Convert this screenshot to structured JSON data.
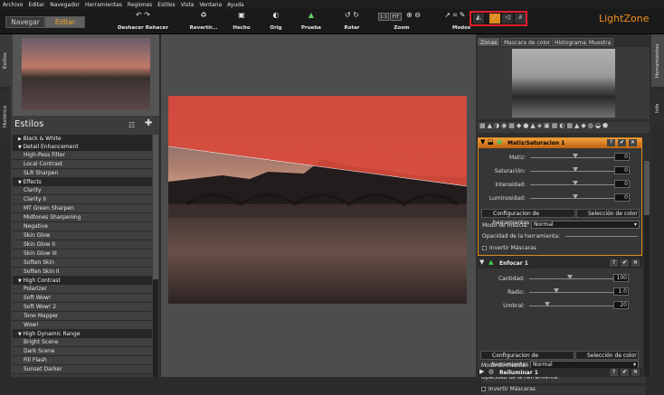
{
  "menu": [
    "Archivo",
    "Editar",
    "Navegador",
    "Herramientas",
    "Regiones",
    "Estilos",
    "Vista",
    "Ventana",
    "Ayuda"
  ],
  "modes": {
    "navegar": "Navegar",
    "editar": "Editar"
  },
  "toolbar": {
    "undo": "Deshacer Rehacer",
    "revert": "Revertir...",
    "done": "Hecho",
    "orig": "Orig",
    "proof": "Prueba",
    "rotate": "Rotar",
    "zoom": "Zoom",
    "modes": "Modos",
    "zoom_11": "1:1",
    "zoom_fit": "FIT"
  },
  "brand": "LightZone",
  "left_tabs": {
    "estilos": "Estilos",
    "historico": "Histórico"
  },
  "styles": {
    "title": "Estilos",
    "items": [
      {
        "t": "cat",
        "l": "Black & White",
        "o": false
      },
      {
        "t": "cat",
        "l": "Detail Enhancement",
        "o": true
      },
      {
        "t": "item",
        "l": "High-Pass Filter"
      },
      {
        "t": "item",
        "l": "Local Contrast"
      },
      {
        "t": "item",
        "l": "SLR Sharpen"
      },
      {
        "t": "cat",
        "l": "Effects",
        "o": true
      },
      {
        "t": "item",
        "l": "Clarity"
      },
      {
        "t": "item",
        "l": "Clarity II"
      },
      {
        "t": "item",
        "l": "MT Green Sharpen"
      },
      {
        "t": "item",
        "l": "Midtones Sharpening"
      },
      {
        "t": "item",
        "l": "Negative"
      },
      {
        "t": "item",
        "l": "Skin Glow"
      },
      {
        "t": "item",
        "l": "Skin Glow II"
      },
      {
        "t": "item",
        "l": "Skin Glow III"
      },
      {
        "t": "item",
        "l": "Soften Skin"
      },
      {
        "t": "item",
        "l": "Soften Skin II"
      },
      {
        "t": "cat",
        "l": "High Contrast",
        "o": true
      },
      {
        "t": "item",
        "l": "Polarizer"
      },
      {
        "t": "item",
        "l": "Soft Wow!"
      },
      {
        "t": "item",
        "l": "Soft Wow! 2"
      },
      {
        "t": "item",
        "l": "Tone Mapper"
      },
      {
        "t": "item",
        "l": "Wow!"
      },
      {
        "t": "cat",
        "l": "High Dynamic Range",
        "o": true
      },
      {
        "t": "item",
        "l": "Bright Scene"
      },
      {
        "t": "item",
        "l": "Dark Scene"
      },
      {
        "t": "item",
        "l": "Fill Flash"
      },
      {
        "t": "item",
        "l": "Sunset Darker"
      }
    ]
  },
  "right_tabs": {
    "herramientas": "Herramientas",
    "info": "Info"
  },
  "preview_tabs": [
    "Zonas",
    "Mascara de color",
    "Histograma",
    "Muestra"
  ],
  "tool1": {
    "title": "Matiz/Saturacion 1",
    "sliders": [
      {
        "label": "Matiz:",
        "value": "0",
        "pos": 0.5
      },
      {
        "label": "Saturación:",
        "value": "0",
        "pos": 0.5
      },
      {
        "label": "Intensidad:",
        "value": "0",
        "pos": 0.5
      },
      {
        "label": "Luminosidad:",
        "value": "0",
        "pos": 0.5
      }
    ],
    "tab_config": "Configuracion de herramientas",
    "tab_color": "Selección de color",
    "blend_label": "Modo de mezcla:",
    "blend_value": "Normal",
    "opacity_label": "Opacidad de la herramienta:",
    "invert": "Invertir Máscaras"
  },
  "tool2": {
    "title": "Enfocar 1",
    "sliders": [
      {
        "label": "Cantidad:",
        "value": "100",
        "pos": 0.45
      },
      {
        "label": "Radio:",
        "value": "1.0",
        "pos": 0.3
      },
      {
        "label": "Umbral:",
        "value": "20",
        "pos": 0.2
      }
    ],
    "tab_config": "Configuracion de herramientas",
    "tab_color": "Selección de color",
    "blend_label": "Modo de mezcla:",
    "blend_value": "Normal",
    "opacity_label": "Opacidad de la herramienta:",
    "invert": "Invertir Máscaras"
  },
  "tool3": {
    "title": "Reiluminar 1"
  },
  "colors": {
    "accent": "#e08a1e",
    "mask": "#d94a3b",
    "brand": "#f09020"
  }
}
